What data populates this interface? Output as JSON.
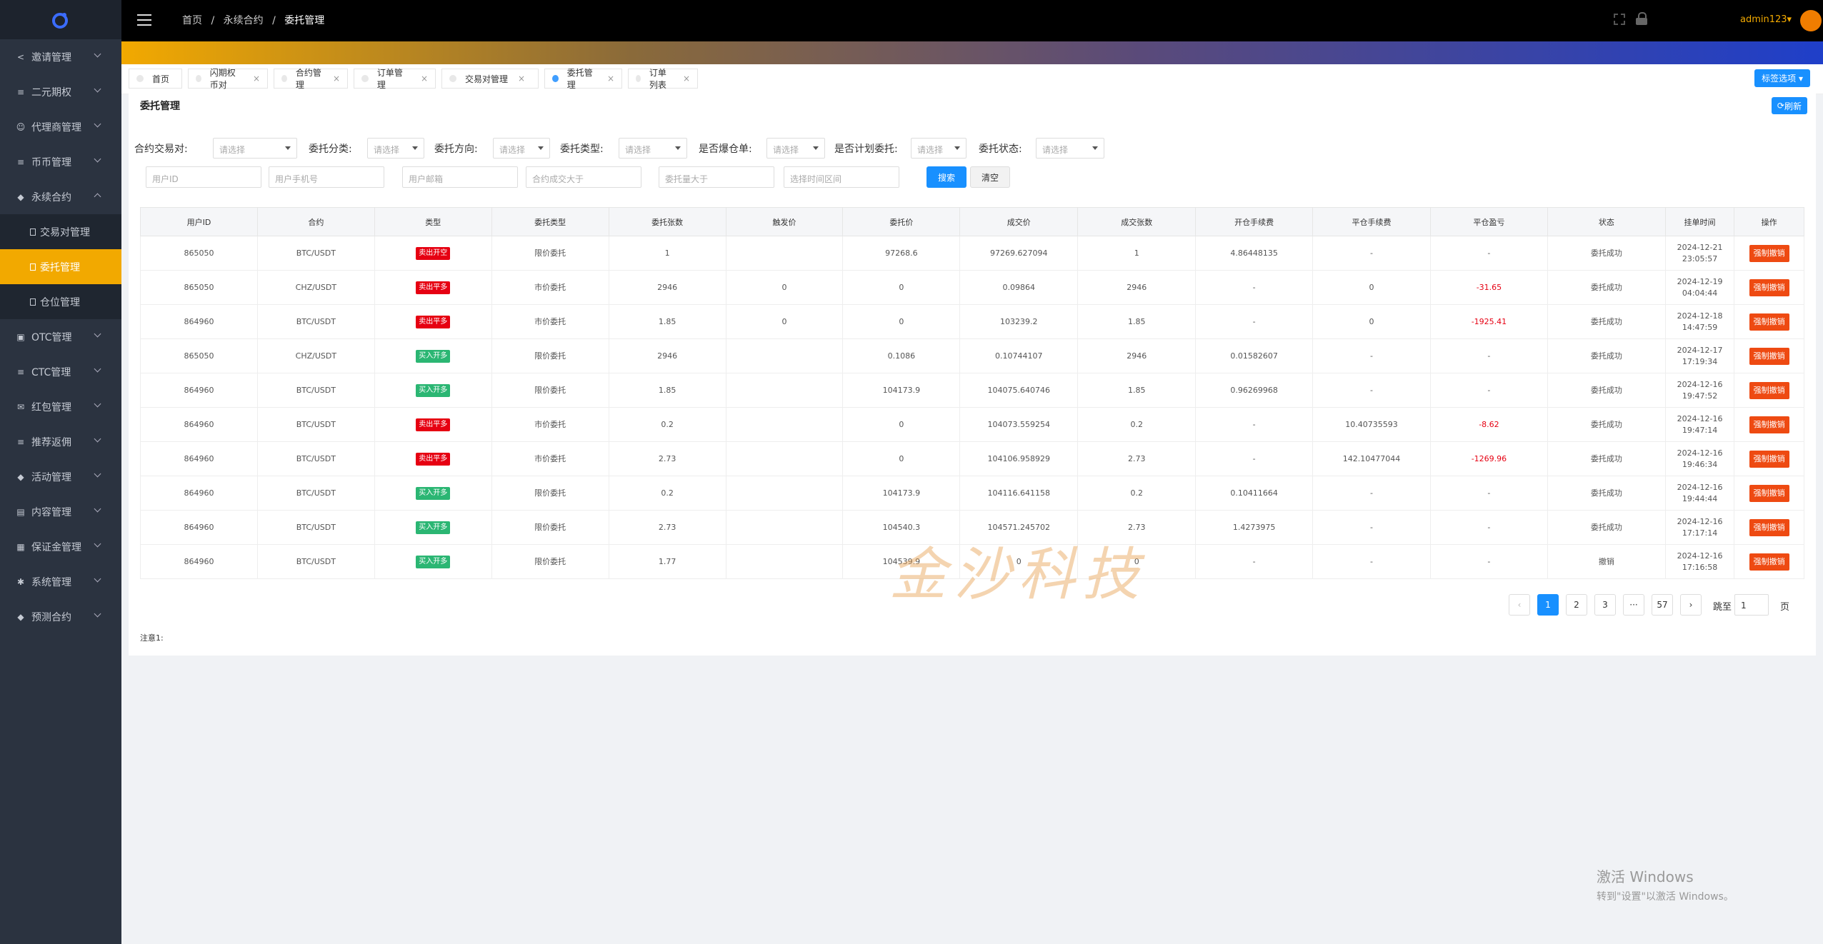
{
  "sidebar": {
    "items": [
      {
        "label": "邀请管理",
        "icon": "share-icon",
        "open": false
      },
      {
        "label": "二元期权",
        "icon": "sliders-icon",
        "open": false
      },
      {
        "label": "代理商管理",
        "icon": "users-icon",
        "open": false
      },
      {
        "label": "币币管理",
        "icon": "sliders-icon",
        "open": false
      },
      {
        "label": "永续合约",
        "icon": "cube-icon",
        "open": true
      },
      {
        "label": "交易对管理",
        "sub": true,
        "active": false
      },
      {
        "label": "委托管理",
        "sub": true,
        "active": true
      },
      {
        "label": "仓位管理",
        "sub": true,
        "active": false
      },
      {
        "label": "OTC管理",
        "icon": "briefcase-icon",
        "open": false
      },
      {
        "label": "CTC管理",
        "icon": "sliders-icon",
        "open": false
      },
      {
        "label": "红包管理",
        "icon": "envelope-icon",
        "open": false
      },
      {
        "label": "推荐返佣",
        "icon": "sliders-icon",
        "open": false
      },
      {
        "label": "活动管理",
        "icon": "cube-icon",
        "open": false
      },
      {
        "label": "内容管理",
        "icon": "inbox-icon",
        "open": false
      },
      {
        "label": "保证金管理",
        "icon": "card-icon",
        "open": false
      },
      {
        "label": "系统管理",
        "icon": "gear-icon",
        "open": false
      },
      {
        "label": "预测合约",
        "icon": "cube-icon",
        "open": false
      }
    ]
  },
  "header": {
    "breadcrumb": [
      "首页",
      "永续合约",
      "委托管理"
    ],
    "user": "admin123"
  },
  "tabs": [
    {
      "label": "首页",
      "closable": false,
      "active": false
    },
    {
      "label": "闪期权币对",
      "closable": true,
      "active": false
    },
    {
      "label": "合约管理",
      "closable": true,
      "active": false
    },
    {
      "label": "订单管理",
      "closable": true,
      "active": false
    },
    {
      "label": "交易对管理",
      "closable": true,
      "active": false
    },
    {
      "label": "委托管理",
      "closable": true,
      "active": true
    },
    {
      "label": "订单列表",
      "closable": true,
      "active": false
    }
  ],
  "tab_select_label": "标签选项",
  "page": {
    "title": "委托管理",
    "refresh_label": "刷新"
  },
  "filters": {
    "labels": [
      "合约交易对:",
      "委托分类:",
      "委托方向:",
      "委托类型:",
      "是否爆仓单:",
      "是否计划委托:",
      "委托状态:"
    ],
    "select_placeholder": "请选择",
    "inputs": [
      "用户ID",
      "用户手机号",
      "用户邮箱",
      "合约成交大于",
      "委托量大于",
      "选择时间区间"
    ],
    "search_label": "搜索",
    "clear_label": "清空"
  },
  "table": {
    "headers": [
      "用户ID",
      "合约",
      "类型",
      "委托类型",
      "委托张数",
      "触发价",
      "委托价",
      "成交价",
      "成交张数",
      "开仓手续费",
      "平仓手续费",
      "平仓盈亏",
      "状态",
      "挂单时间",
      "操作"
    ],
    "action_label": "强制撤销",
    "rows": [
      {
        "uid": "865050",
        "pair": "BTC/USDT",
        "type": "卖出开空",
        "type_color": "red",
        "otype": "限价委托",
        "qty": "1",
        "trigger": "",
        "price": "97268.6",
        "deal": "97269.627094",
        "dqty": "1",
        "openfee": "4.86448135",
        "closefee": "-",
        "pnl": "-",
        "pnl_neg": false,
        "status": "委托成功",
        "date": "2024-12-21",
        "time": "23:05:57"
      },
      {
        "uid": "865050",
        "pair": "CHZ/USDT",
        "type": "卖出平多",
        "type_color": "red",
        "otype": "市价委托",
        "qty": "2946",
        "trigger": "0",
        "price": "0",
        "deal": "0.09864",
        "dqty": "2946",
        "openfee": "-",
        "closefee": "0",
        "pnl": "-31.65",
        "pnl_neg": true,
        "status": "委托成功",
        "date": "2024-12-19",
        "time": "04:04:44"
      },
      {
        "uid": "864960",
        "pair": "BTC/USDT",
        "type": "卖出平多",
        "type_color": "red",
        "otype": "市价委托",
        "qty": "1.85",
        "trigger": "0",
        "price": "0",
        "deal": "103239.2",
        "dqty": "1.85",
        "openfee": "-",
        "closefee": "0",
        "pnl": "-1925.41",
        "pnl_neg": true,
        "status": "委托成功",
        "date": "2024-12-18",
        "time": "14:47:59"
      },
      {
        "uid": "865050",
        "pair": "CHZ/USDT",
        "type": "买入开多",
        "type_color": "green",
        "otype": "限价委托",
        "qty": "2946",
        "trigger": "",
        "price": "0.1086",
        "deal": "0.10744107",
        "dqty": "2946",
        "openfee": "0.01582607",
        "closefee": "-",
        "pnl": "-",
        "pnl_neg": false,
        "status": "委托成功",
        "date": "2024-12-17",
        "time": "17:19:34"
      },
      {
        "uid": "864960",
        "pair": "BTC/USDT",
        "type": "买入开多",
        "type_color": "green",
        "otype": "限价委托",
        "qty": "1.85",
        "trigger": "",
        "price": "104173.9",
        "deal": "104075.640746",
        "dqty": "1.85",
        "openfee": "0.96269968",
        "closefee": "-",
        "pnl": "-",
        "pnl_neg": false,
        "status": "委托成功",
        "date": "2024-12-16",
        "time": "19:47:52"
      },
      {
        "uid": "864960",
        "pair": "BTC/USDT",
        "type": "卖出平多",
        "type_color": "red",
        "otype": "市价委托",
        "qty": "0.2",
        "trigger": "",
        "price": "0",
        "deal": "104073.559254",
        "dqty": "0.2",
        "openfee": "-",
        "closefee": "10.40735593",
        "pnl": "-8.62",
        "pnl_neg": true,
        "status": "委托成功",
        "date": "2024-12-16",
        "time": "19:47:14"
      },
      {
        "uid": "864960",
        "pair": "BTC/USDT",
        "type": "卖出平多",
        "type_color": "red",
        "otype": "市价委托",
        "qty": "2.73",
        "trigger": "",
        "price": "0",
        "deal": "104106.958929",
        "dqty": "2.73",
        "openfee": "-",
        "closefee": "142.10477044",
        "pnl": "-1269.96",
        "pnl_neg": true,
        "status": "委托成功",
        "date": "2024-12-16",
        "time": "19:46:34"
      },
      {
        "uid": "864960",
        "pair": "BTC/USDT",
        "type": "买入开多",
        "type_color": "green",
        "otype": "限价委托",
        "qty": "0.2",
        "trigger": "",
        "price": "104173.9",
        "deal": "104116.641158",
        "dqty": "0.2",
        "openfee": "0.10411664",
        "closefee": "-",
        "pnl": "-",
        "pnl_neg": false,
        "status": "委托成功",
        "date": "2024-12-16",
        "time": "19:44:44"
      },
      {
        "uid": "864960",
        "pair": "BTC/USDT",
        "type": "买入开多",
        "type_color": "green",
        "otype": "限价委托",
        "qty": "2.73",
        "trigger": "",
        "price": "104540.3",
        "deal": "104571.245702",
        "dqty": "2.73",
        "openfee": "1.4273975",
        "closefee": "-",
        "pnl": "-",
        "pnl_neg": false,
        "status": "委托成功",
        "date": "2024-12-16",
        "time": "17:17:14"
      },
      {
        "uid": "864960",
        "pair": "BTC/USDT",
        "type": "买入开多",
        "type_color": "green",
        "otype": "限价委托",
        "qty": "1.77",
        "trigger": "",
        "price": "104539.9",
        "deal": "0",
        "dqty": "0",
        "openfee": "-",
        "closefee": "-",
        "pnl": "-",
        "pnl_neg": false,
        "status": "撤销",
        "date": "2024-12-16",
        "time": "17:16:58"
      }
    ]
  },
  "pagination": {
    "pages": [
      "1",
      "2",
      "3",
      "···",
      "57"
    ],
    "current": "1",
    "jump_label": "跳至",
    "jump_value": "1",
    "page_suffix": "页"
  },
  "note": "注意1:",
  "watermark": "金沙科技",
  "activation": {
    "title": "激活 Windows",
    "subtitle": "转到\"设置\"以激活 Windows。"
  },
  "colors": {
    "sidebar_bg": "#2b3340",
    "active_accent": "#f2a900",
    "primary": "#1890ff",
    "danger": "#ee4a12",
    "buy_green": "#2bb673",
    "sell_red": "#e60012"
  }
}
